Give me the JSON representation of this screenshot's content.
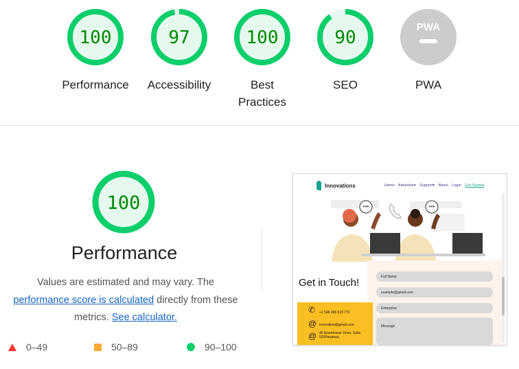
{
  "gauges": [
    {
      "label": "Performance",
      "score": "100",
      "value": 100,
      "status": "pass"
    },
    {
      "label": "Accessibility",
      "score": "97",
      "value": 97,
      "status": "pass"
    },
    {
      "label": "Best Practices",
      "score": "100",
      "value": 100,
      "status": "pass"
    },
    {
      "label": "SEO",
      "score": "90",
      "value": 90,
      "status": "pass"
    },
    {
      "label": "PWA",
      "score": "",
      "value": null,
      "status": "na",
      "badge_text": "PWA"
    }
  ],
  "performance": {
    "score": "100",
    "value": 100,
    "title": "Performance",
    "desc_1": "Values are estimated and may vary. The",
    "desc_link": "performance score is calculated",
    "desc_2": "directly from these metrics.",
    "calc_link": "See calculator."
  },
  "legend": [
    {
      "range": "0–49",
      "shape": "triangle",
      "color": "#ff3333"
    },
    {
      "range": "50–89",
      "shape": "square",
      "color": "#ffaa33"
    },
    {
      "range": "90–100",
      "shape": "circle",
      "color": "#0cce6b"
    }
  ],
  "screenshot": {
    "brand": "Innovations",
    "nav": [
      "Home",
      "Advertise▾",
      "Support▾",
      "About",
      "Login"
    ],
    "nav_cta": "Get Started",
    "heading": "Get in Touch!",
    "fields": [
      "Full Name",
      "example@gmail.com",
      "Enterprise",
      "Message"
    ],
    "contact": {
      "phone": "+1 548 496 523 772",
      "email": "innovation@gmail.com",
      "address": "45 Eisenhower Drive, Suite 520Paramus,"
    }
  },
  "colors": {
    "pass": "#0cce6b",
    "pass_fill": "#e6f9ee",
    "pass_text": "#008800",
    "na": "#cccccc"
  }
}
